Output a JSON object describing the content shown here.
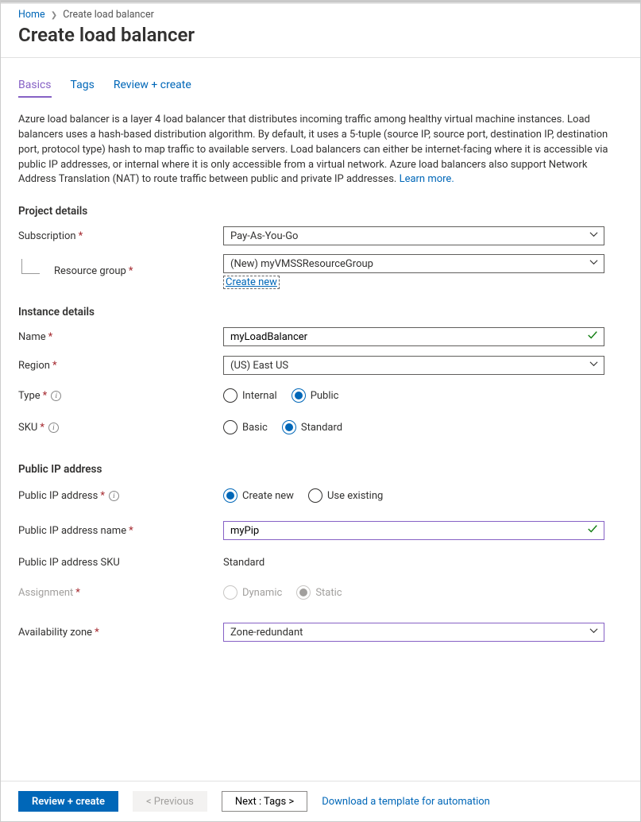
{
  "breadcrumb": {
    "home": "Home",
    "current": "Create load balancer"
  },
  "page_title": "Create load balancer",
  "tabs": {
    "basics": "Basics",
    "tags": "Tags",
    "review": "Review + create"
  },
  "description_text": "Azure load balancer is a layer 4 load balancer that distributes incoming traffic among healthy virtual machine instances. Load balancers uses a hash-based distribution algorithm. By default, it uses a 5-tuple (source IP, source port, destination IP, destination port, protocol type) hash to map traffic to available servers. Load balancers can either be internet-facing where it is accessible via public IP addresses, or internal where it is only accessible from a virtual network. Azure load balancers also support Network Address Translation (NAT) to route traffic between public and private IP addresses.  ",
  "learn_more": "Learn more.",
  "sections": {
    "project": "Project details",
    "instance": "Instance details",
    "publicip": "Public IP address"
  },
  "labels": {
    "subscription": "Subscription",
    "resource_group": "Resource group",
    "name": "Name",
    "region": "Region",
    "type": "Type",
    "sku": "SKU",
    "public_ip": "Public IP address",
    "public_ip_name": "Public IP address name",
    "public_ip_sku": "Public IP address SKU",
    "assignment": "Assignment",
    "availability_zone": "Availability zone"
  },
  "values": {
    "subscription": "Pay-As-You-Go",
    "resource_group": "(New) myVMSSResourceGroup",
    "create_new": "Create new",
    "name": "myLoadBalancer",
    "region": "(US) East US",
    "public_ip_name": "myPip",
    "public_ip_sku": "Standard",
    "availability_zone": "Zone-redundant"
  },
  "radios": {
    "type_internal": "Internal",
    "type_public": "Public",
    "sku_basic": "Basic",
    "sku_standard": "Standard",
    "pip_create": "Create new",
    "pip_existing": "Use existing",
    "assign_dynamic": "Dynamic",
    "assign_static": "Static"
  },
  "footer": {
    "review": "Review + create",
    "previous": "< Previous",
    "next": "Next : Tags >",
    "download": "Download a template for automation"
  }
}
